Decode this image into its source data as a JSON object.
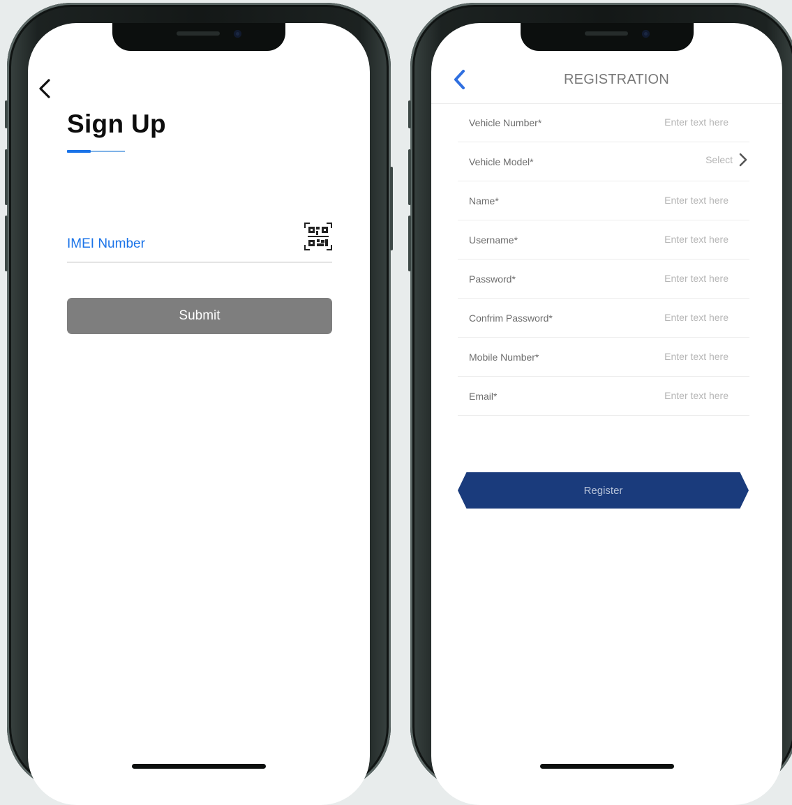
{
  "signup_screen": {
    "title": "Sign Up",
    "imei_label": "IMEI Number",
    "submit_label": "Submit",
    "icons": {
      "back": "chevron-left-icon",
      "scan": "qr-code-icon"
    },
    "colors": {
      "accent": "#1a73e8",
      "submit_bg": "#7e7e7e"
    }
  },
  "registration_screen": {
    "title": "REGISTRATION",
    "fields": [
      {
        "label": "Vehicle Number*",
        "placeholder": "Enter text here"
      },
      {
        "label": "Vehicle Model*",
        "placeholder": "Select"
      },
      {
        "label": "Name*",
        "placeholder": "Enter text here"
      },
      {
        "label": "Username*",
        "placeholder": "Enter text here"
      },
      {
        "label": "Password*",
        "placeholder": "Enter text here"
      },
      {
        "label": "Confrim Password*",
        "placeholder": "Enter text here"
      },
      {
        "label": "Mobile Number*",
        "placeholder": "Enter text here"
      },
      {
        "label": "Email*",
        "placeholder": "Enter text here"
      }
    ],
    "register_label": "Register",
    "icons": {
      "back": "chevron-left-icon",
      "select": "chevron-right-icon"
    },
    "colors": {
      "back": "#2f6fe0",
      "register_bg": "#1a3b7c"
    }
  }
}
